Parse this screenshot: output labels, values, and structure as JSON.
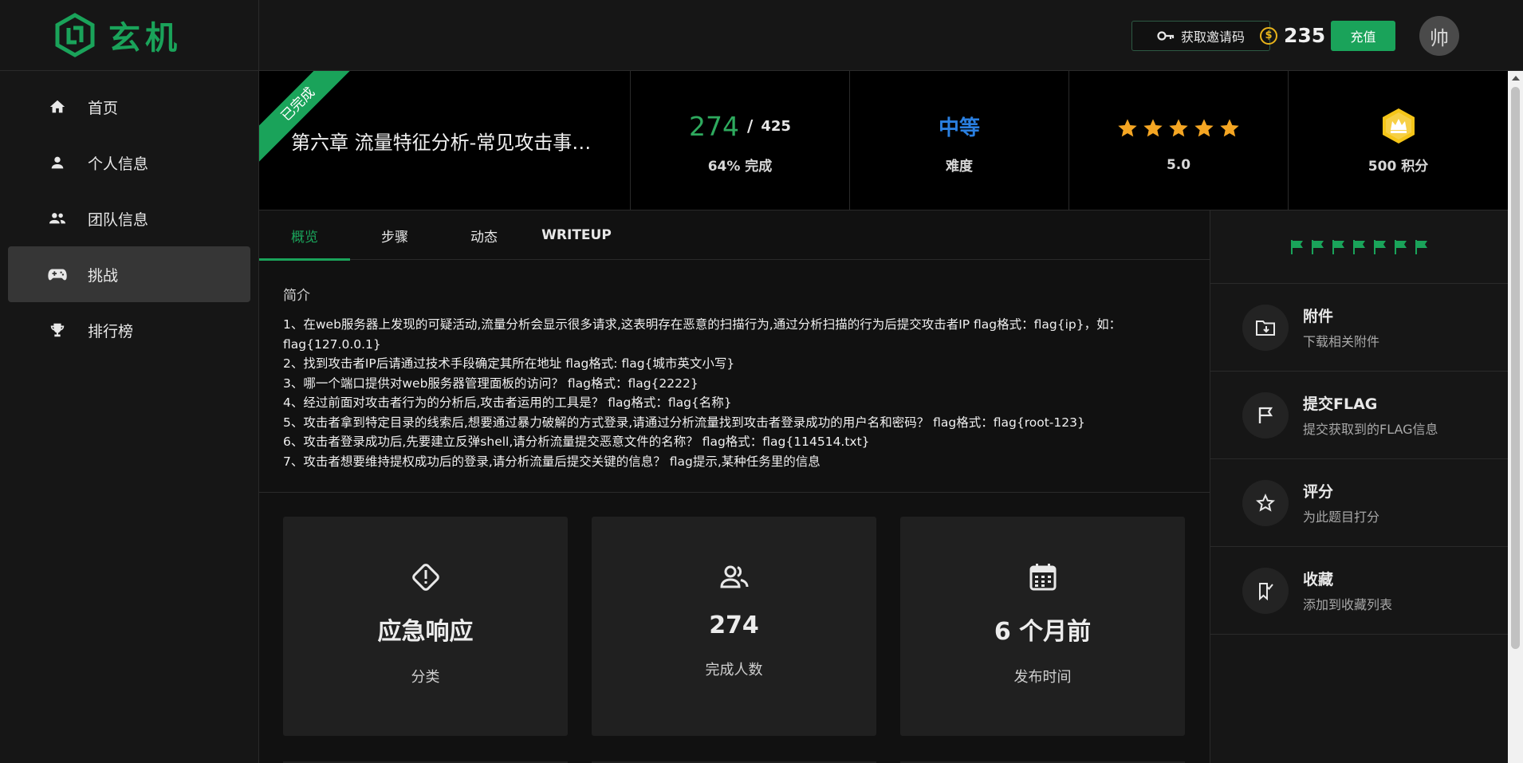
{
  "app": {
    "logo_text": "玄机",
    "brand_color": "#1aa35a"
  },
  "sidebar": {
    "items": [
      {
        "label": "首页",
        "icon": "home-icon"
      },
      {
        "label": "个人信息",
        "icon": "user-icon"
      },
      {
        "label": "团队信息",
        "icon": "team-icon"
      },
      {
        "label": "挑战",
        "icon": "gamepad-icon",
        "active": true
      },
      {
        "label": "排行榜",
        "icon": "trophy-icon"
      }
    ]
  },
  "topbar": {
    "invite_label": "获取邀请码",
    "coin_symbol": "$",
    "coins": "235",
    "recharge_label": "充值",
    "avatar_text": "帅"
  },
  "challenge": {
    "status_ribbon": "已完成",
    "title": "第六章 流量特征分析-常见攻击事件 tomcat",
    "progress_done": "274",
    "progress_sep": "/",
    "progress_total": "425",
    "progress_text": "64% 完成",
    "difficulty": "中等",
    "difficulty_label": "难度",
    "rating": "5.0",
    "rating_stars": 5,
    "points_label": "500 积分"
  },
  "tabs": [
    {
      "label": "概览",
      "active": true
    },
    {
      "label": "步骤"
    },
    {
      "label": "动态"
    },
    {
      "label": "WRITEUP"
    }
  ],
  "intro": {
    "heading": "简介",
    "lines": [
      "1、在web服务器上发现的可疑活动,流量分析会显示很多请求,这表明存在恶意的扫描行为,通过分析扫描的行为后提交攻击者IP flag格式：flag{ip}，如：flag{127.0.0.1}",
      "2、找到攻击者IP后请通过技术手段确定其所在地址 flag格式: flag{城市英文小写}",
      "3、哪一个端口提供对web服务器管理面板的访问？ flag格式：flag{2222}",
      "4、经过前面对攻击者行为的分析后,攻击者运用的工具是？ flag格式：flag{名称}",
      "5、攻击者拿到特定目录的线索后,想要通过暴力破解的方式登录,请通过分析流量找到攻击者登录成功的用户名和密码？ flag格式：flag{root-123}",
      "6、攻击者登录成功后,先要建立反弹shell,请分析流量提交恶意文件的名称？ flag格式：flag{114514.txt}",
      "7、攻击者想要维持提权成功后的登录,请分析流量后提交关键的信息？ flag提示,某种任务里的信息"
    ]
  },
  "cards": [
    {
      "icon": "alert-diamond-icon",
      "value": "应急响应",
      "label": "分类"
    },
    {
      "icon": "users-icon",
      "value": "274",
      "label": "完成人数"
    },
    {
      "icon": "calendar-icon",
      "value": "6 个月前",
      "label": "发布时间"
    }
  ],
  "right_panel": {
    "flag_count": 7,
    "actions": [
      {
        "icon": "folder-download-icon",
        "title": "附件",
        "subtitle": "下载相关附件"
      },
      {
        "icon": "flag-icon",
        "title": "提交FLAG",
        "subtitle": "提交获取到的FLAG信息"
      },
      {
        "icon": "star-outline-icon",
        "title": "评分",
        "subtitle": "为此题目打分"
      },
      {
        "icon": "bookmark-check-icon",
        "title": "收藏",
        "subtitle": "添加到收藏列表"
      }
    ]
  }
}
